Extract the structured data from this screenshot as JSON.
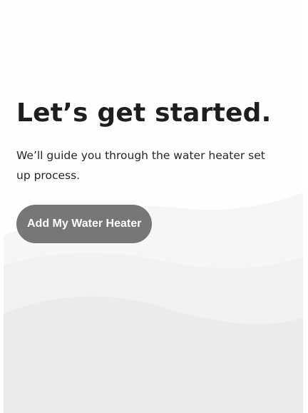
{
  "onboarding": {
    "title": "Let’s get started.",
    "subtitle": "We’ll guide you through the water heater set up process.",
    "add_button_label": "Add My Water Heater"
  },
  "colors": {
    "button_background": "#777777",
    "button_text": "#ffffff",
    "wave_light": "#f4f4f4",
    "wave_mid": "#eeeeee",
    "wave_dark": "#e8e8e8"
  }
}
